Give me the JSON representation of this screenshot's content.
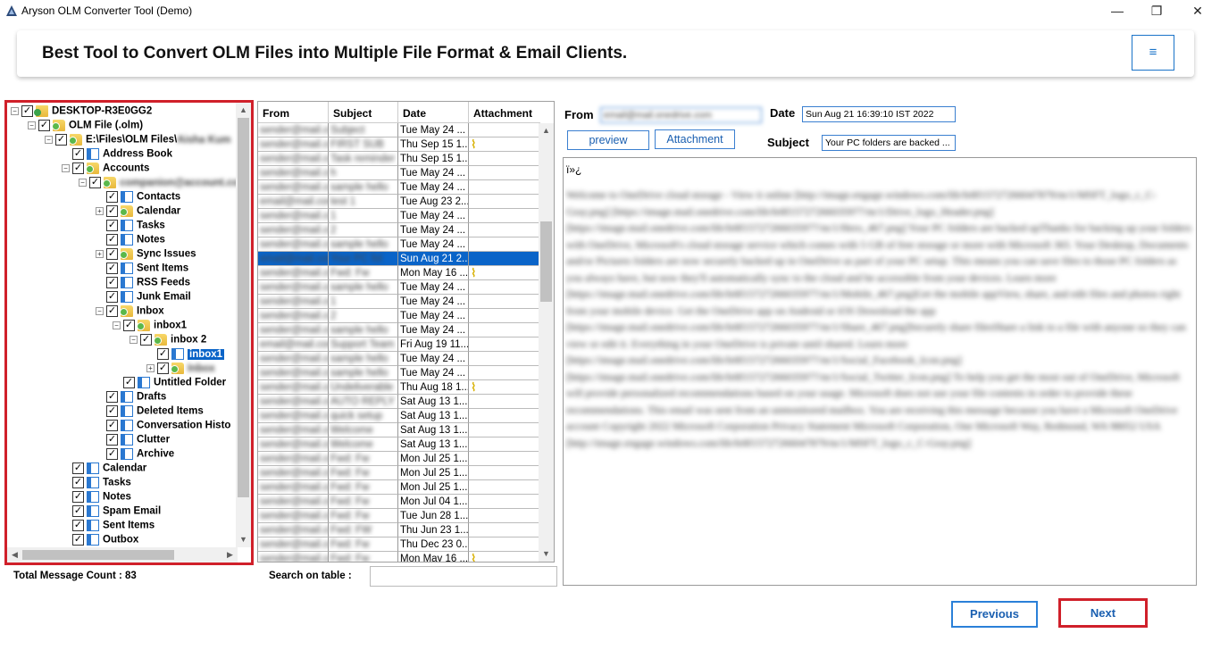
{
  "window": {
    "title": "Aryson OLM Converter Tool (Demo)",
    "minimize": "—",
    "maximize": "❐",
    "close": "✕"
  },
  "banner": {
    "title": "Best Tool to Convert OLM Files into Multiple File Format & Email Clients.",
    "menu_icon": "≡"
  },
  "tree": {
    "items": [
      {
        "label": "DESKTOP-R3E0GG2",
        "icon": "pc-icon",
        "level": 0,
        "expander": "−"
      },
      {
        "label": "OLM File (.olm)",
        "icon": "folder-icon",
        "level": 1,
        "expander": "−"
      },
      {
        "label": "E:\\Files\\OLM Files\\",
        "icon": "folder-icon",
        "level": 2,
        "expander": "−",
        "blur_suffix": "Aisha Kum"
      },
      {
        "label": "Address Book",
        "icon": "page-icon",
        "level": 3,
        "expander": ""
      },
      {
        "label": "Accounts",
        "icon": "folder-icon",
        "level": 3,
        "expander": "−"
      },
      {
        "label": "",
        "icon": "folder-icon",
        "level": 4,
        "expander": "−",
        "blur_suffix": "companion@account.com"
      },
      {
        "label": "Contacts",
        "icon": "page-icon",
        "level": 5,
        "expander": ""
      },
      {
        "label": "Calendar",
        "icon": "folder-icon",
        "level": 5,
        "expander": "+"
      },
      {
        "label": "Tasks",
        "icon": "page-icon",
        "level": 5,
        "expander": ""
      },
      {
        "label": "Notes",
        "icon": "page-icon",
        "level": 5,
        "expander": ""
      },
      {
        "label": "Sync Issues",
        "icon": "folder-icon",
        "level": 5,
        "expander": "+"
      },
      {
        "label": "Sent Items",
        "icon": "page-icon",
        "level": 5,
        "expander": ""
      },
      {
        "label": "RSS Feeds",
        "icon": "page-icon",
        "level": 5,
        "expander": ""
      },
      {
        "label": "Junk Email",
        "icon": "page-icon",
        "level": 5,
        "expander": ""
      },
      {
        "label": "Inbox",
        "icon": "folder-icon",
        "level": 5,
        "expander": "−"
      },
      {
        "label": "inbox1",
        "icon": "folder-icon",
        "level": 6,
        "expander": "−"
      },
      {
        "label": "inbox 2",
        "icon": "folder-icon",
        "level": 7,
        "expander": "−"
      },
      {
        "label": "inbox1",
        "icon": "page-icon",
        "level": 8,
        "expander": "",
        "selected": true
      },
      {
        "label": "",
        "icon": "folder-icon",
        "level": 8,
        "expander": "+",
        "blur_suffix": "Inbox"
      },
      {
        "label": "Untitled Folder",
        "icon": "page-icon",
        "level": 6,
        "expander": ""
      },
      {
        "label": "Drafts",
        "icon": "page-icon",
        "level": 5,
        "expander": ""
      },
      {
        "label": "Deleted Items",
        "icon": "page-icon",
        "level": 5,
        "expander": ""
      },
      {
        "label": "Conversation Histo",
        "icon": "page-icon",
        "level": 5,
        "expander": ""
      },
      {
        "label": "Clutter",
        "icon": "page-icon",
        "level": 5,
        "expander": ""
      },
      {
        "label": "Archive",
        "icon": "page-icon",
        "level": 5,
        "expander": ""
      },
      {
        "label": "Calendar",
        "icon": "page-icon",
        "level": 3,
        "expander": ""
      },
      {
        "label": "Tasks",
        "icon": "page-icon",
        "level": 3,
        "expander": ""
      },
      {
        "label": "Notes",
        "icon": "page-icon",
        "level": 3,
        "expander": ""
      },
      {
        "label": "Spam Email",
        "icon": "page-icon",
        "level": 3,
        "expander": ""
      },
      {
        "label": "Sent Items",
        "icon": "page-icon",
        "level": 3,
        "expander": ""
      },
      {
        "label": "Outbox",
        "icon": "page-icon",
        "level": 3,
        "expander": ""
      }
    ]
  },
  "total_count": "Total Message Count : 83",
  "table": {
    "headers": [
      "From",
      "Subject",
      "Date",
      "Attachment"
    ],
    "rows": [
      {
        "from": "sender@mail.com",
        "subject": "Subject",
        "date": "Tue May 24 ...",
        "attach": false
      },
      {
        "from": "sender@mail.com",
        "subject": "FIRST SUB",
        "date": "Thu Sep 15 1...",
        "attach": true
      },
      {
        "from": "sender@mail.com",
        "subject": "Task reminder",
        "date": "Thu Sep 15 1...",
        "attach": false
      },
      {
        "from": "sender@mail.com",
        "subject": "h",
        "date": "Tue May 24 ...",
        "attach": false
      },
      {
        "from": "sender@mail.com",
        "subject": "sample hello",
        "date": "Tue May 24 ...",
        "attach": false
      },
      {
        "from": "email@mail.com",
        "subject": "test 1",
        "date": "Tue Aug 23 2...",
        "attach": false
      },
      {
        "from": "sender@mail.com",
        "subject": "1",
        "date": "Tue May 24 ...",
        "attach": false
      },
      {
        "from": "sender@mail.com",
        "subject": "2",
        "date": "Tue May 24 ...",
        "attach": false
      },
      {
        "from": "sender@mail.com",
        "subject": "sample hello",
        "date": "Tue May 24 ...",
        "attach": false
      },
      {
        "from": "email@mail.com",
        "subject": "Your PC fol",
        "date": "Sun Aug 21 2...",
        "attach": false,
        "selected": true
      },
      {
        "from": "sender@mail.com",
        "subject": "Fwd: Fw",
        "date": "Mon May 16 ...",
        "attach": true
      },
      {
        "from": "sender@mail.com",
        "subject": "sample hello",
        "date": "Tue May 24 ...",
        "attach": false
      },
      {
        "from": "sender@mail.com",
        "subject": "1",
        "date": "Tue May 24 ...",
        "attach": false
      },
      {
        "from": "sender@mail.com",
        "subject": "2",
        "date": "Tue May 24 ...",
        "attach": false
      },
      {
        "from": "sender@mail.com",
        "subject": "sample hello",
        "date": "Tue May 24 ...",
        "attach": false
      },
      {
        "from": "email@mail.com",
        "subject": "Support Team",
        "date": "Fri Aug 19 11...",
        "attach": false
      },
      {
        "from": "sender@mail.com",
        "subject": "sample hello",
        "date": "Tue May 24 ...",
        "attach": false
      },
      {
        "from": "sender@mail.com",
        "subject": "sample hello",
        "date": "Tue May 24 ...",
        "attach": false
      },
      {
        "from": "sender@mail.com",
        "subject": "Undeliverable",
        "date": "Thu Aug 18 1...",
        "attach": true
      },
      {
        "from": "sender@mail.com",
        "subject": "AUTO REPLY",
        "date": "Sat Aug 13 1...",
        "attach": false
      },
      {
        "from": "sender@mail.com",
        "subject": "quick setup",
        "date": "Sat Aug 13 1...",
        "attach": false
      },
      {
        "from": "sender@mail.com",
        "subject": "Welcome",
        "date": "Sat Aug 13 1...",
        "attach": false
      },
      {
        "from": "sender@mail.com",
        "subject": "Welcome",
        "date": "Sat Aug 13 1...",
        "attach": false
      },
      {
        "from": "sender@mail.com",
        "subject": "Fwd: Fw",
        "date": "Mon Jul 25 1...",
        "attach": false
      },
      {
        "from": "sender@mail.com",
        "subject": "Fwd: Fw",
        "date": "Mon Jul 25 1...",
        "attach": false
      },
      {
        "from": "sender@mail.com",
        "subject": "Fwd: Fw",
        "date": "Mon Jul 25 1...",
        "attach": false
      },
      {
        "from": "sender@mail.com",
        "subject": "Fwd: Fw",
        "date": "Mon Jul 04 1...",
        "attach": false
      },
      {
        "from": "sender@mail.com",
        "subject": "Fwd: Fw",
        "date": "Tue Jun 28 1...",
        "attach": false
      },
      {
        "from": "sender@mail.com",
        "subject": "Fwd: FW",
        "date": "Thu Jun 23 1...",
        "attach": false
      },
      {
        "from": "sender@mail.com",
        "subject": "Fwd: Fw",
        "date": "Thu Dec 23 0...",
        "attach": false
      },
      {
        "from": "sender@mail.com",
        "subject": "Fwd: Fw",
        "date": "Mon May 16 ...",
        "attach": true
      }
    ]
  },
  "search": {
    "label": "Search on table :",
    "value": ""
  },
  "preview": {
    "from_label": "From",
    "from_value": "email@mail.onedrive.com",
    "date_label": "Date",
    "date_value": "Sun Aug 21 16:39:10 IST 2022",
    "subject_label": "Subject",
    "subject_value": "Your PC folders are backed ...",
    "preview_button": "preview",
    "attachment_button": "Attachment",
    "body_start": "ï»¿",
    "body_text": "Welcome to OneDrive cloud storage - View it online [http://image.engage.windows.com/lib/fe8f15727266047879/m/1/MSFT_logo_c_C-Gray.png] [https://image.mail.onedrive.com/lib/fe8f15727266035977/m/1/Drive_logo_Header.png] [https://image.mail.onedrive.com/lib/fe8f15727266035977/m/1/Hero_467.png] Your PC folders are backed upThanks for backing up your folders with OneDrive, Microsoft's cloud storage service which comes with 5 GB of free storage or more with Microsoft 365. Your Desktop, Documents and/or Pictures folders are now securely backed up in OneDrive as part of your PC setup. This means you can save files to those PC folders as you always have, but now they'll automatically sync to the cloud and be accessible from your devices. Learn more [https://image.mail.onedrive.com/lib/fe8f15727266035977/m/1/Mobile_467.png]Get the mobile appView, share, and edit files and photos right from your mobile device. Get the OneDrive app on Android or iOS Download the app [https://image.mail.onedrive.com/lib/fe8f15727266035977/m/1/Share_467.png]Securely share filesShare a link to a file with anyone so they can view or edit it. Everything in your OneDrive is private until shared. Learn more [https://image.mail.onedrive.com/lib/fe8f15727266035977/m/1/Social_Facebook_Icon.png] [https://image.mail.onedrive.com/lib/fe8f15727266035977/m/1/Social_Twitter_Icon.png] To help you get the most out of OneDrive, Microsoft will provide personalized recommendations based on your usage. Microsoft does not use your file contents in order to provide these recommendations. This email was sent from an unmonitored mailbox. You are receiving this message because you have a Microsoft OneDrive account Copyright 2022 Microsoft Corporation Privacy Statement Microsoft Corporation, One Microsoft Way, Redmond, WA 98052 USA [http://image.engage.windows.com/lib/fe8f15727266047879/m/1/MSFT_logo_c_C-Gray.png]"
  },
  "buttons": {
    "previous": "Previous",
    "next": "Next"
  },
  "colors": {
    "accent_blue": "#1a73c8",
    "highlight_red": "#d0202a",
    "selection": "#0a64c8"
  }
}
